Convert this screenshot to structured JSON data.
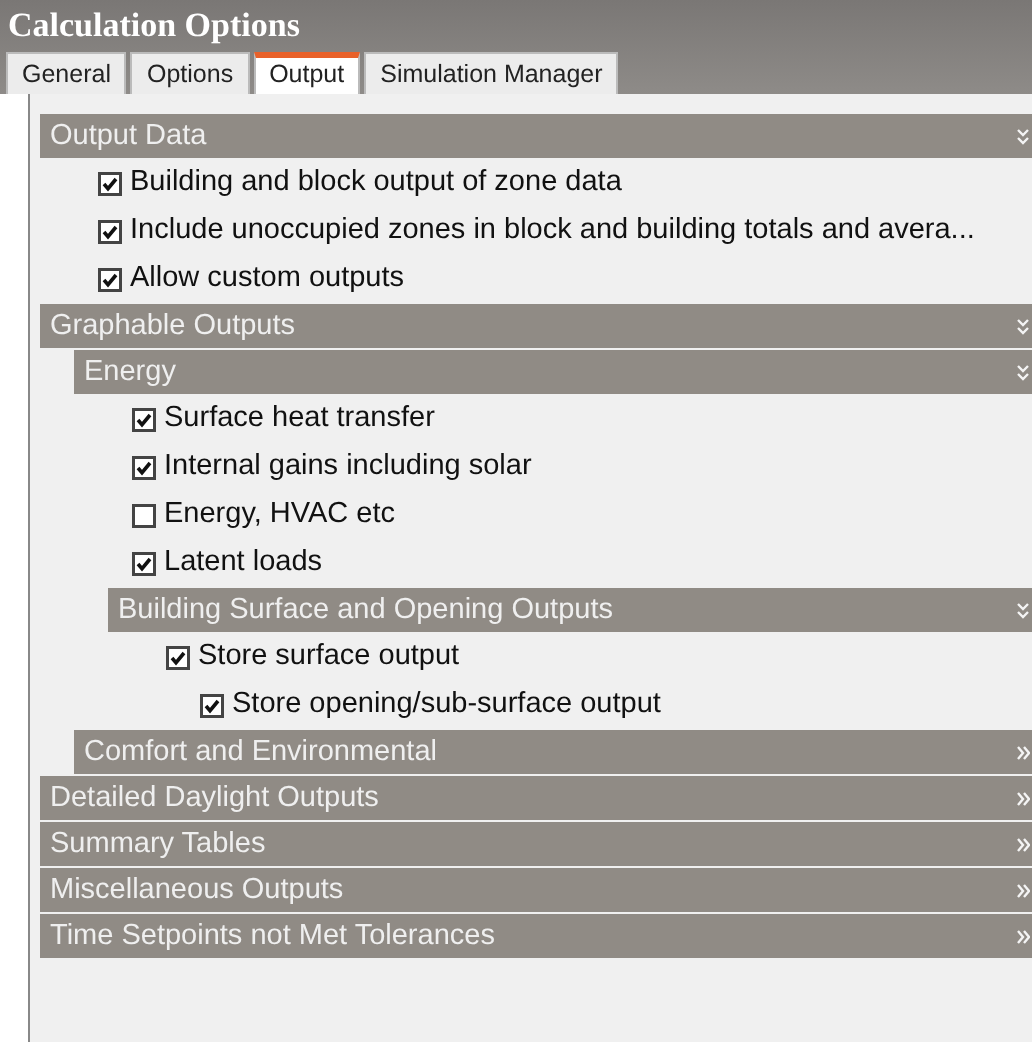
{
  "window": {
    "title": "Calculation Options"
  },
  "tabs": [
    {
      "label": "General",
      "selected": false
    },
    {
      "label": "Options",
      "selected": false
    },
    {
      "label": "Output",
      "selected": true
    },
    {
      "label": "Simulation Manager",
      "selected": false
    }
  ],
  "sections": [
    {
      "kind": "section",
      "title": "Output Data",
      "expanded": true,
      "children": [
        {
          "kind": "checkbox",
          "label": "Building and block output of zone data",
          "checked": true
        },
        {
          "kind": "checkbox",
          "label": "Include unoccupied zones in block and building totals and avera...",
          "checked": true
        },
        {
          "kind": "checkbox",
          "label": "Allow custom outputs",
          "checked": true
        }
      ]
    },
    {
      "kind": "section",
      "title": "Graphable Outputs",
      "expanded": true,
      "children": [
        {
          "kind": "section",
          "title": "Energy",
          "expanded": true,
          "children": [
            {
              "kind": "checkbox",
              "label": "Surface heat transfer",
              "checked": true
            },
            {
              "kind": "checkbox",
              "label": "Internal gains including solar",
              "checked": true
            },
            {
              "kind": "checkbox",
              "label": "Energy, HVAC etc",
              "checked": false
            },
            {
              "kind": "checkbox",
              "label": "Latent loads",
              "checked": true
            },
            {
              "kind": "section",
              "title": "Building Surface and Opening Outputs",
              "expanded": true,
              "children": [
                {
                  "kind": "checkbox",
                  "label": "Store surface output",
                  "checked": true,
                  "children": [
                    {
                      "kind": "checkbox",
                      "label": "Store opening/sub-surface output",
                      "checked": true
                    }
                  ]
                }
              ]
            }
          ]
        },
        {
          "kind": "section",
          "title": "Comfort and Environmental",
          "expanded": false
        }
      ]
    },
    {
      "kind": "section",
      "title": "Detailed Daylight Outputs",
      "expanded": false
    },
    {
      "kind": "section",
      "title": "Summary Tables",
      "expanded": false
    },
    {
      "kind": "section",
      "title": "Miscellaneous Outputs",
      "expanded": false
    },
    {
      "kind": "section",
      "title": "Time Setpoints not Met Tolerances",
      "expanded": false
    }
  ]
}
